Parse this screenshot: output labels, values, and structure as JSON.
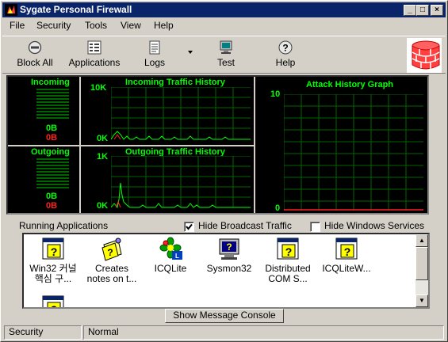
{
  "window": {
    "title": "Sygate Personal Firewall"
  },
  "title_buttons": {
    "minimize": "_",
    "maximize": "□",
    "close": "×"
  },
  "menu": [
    "File",
    "Security",
    "Tools",
    "View",
    "Help"
  ],
  "toolbar": {
    "block_all": "Block All",
    "applications": "Applications",
    "logs": "Logs",
    "test": "Test",
    "help": "Help"
  },
  "graphs": {
    "incoming": {
      "title": "Incoming",
      "count_a": "0B",
      "count_b": "0B"
    },
    "outgoing": {
      "title": "Outgoing",
      "count_a": "0B",
      "count_b": "0B"
    },
    "incoming_history": {
      "title": "Incoming Traffic History",
      "max": "10K",
      "min": "0K"
    },
    "outgoing_history": {
      "title": "Outgoing Traffic History",
      "max": "1K",
      "min": "0K"
    },
    "attack_history": {
      "title": "Attack History Graph",
      "max": "10",
      "min": "0"
    },
    "colors": {
      "green": "#00ff00",
      "red": "#ff2020",
      "grid": "#006600"
    }
  },
  "apps": {
    "label": "Running Applications",
    "hide_broadcast": {
      "label": "Hide Broadcast Traffic",
      "checked": true
    },
    "hide_windows_services": {
      "label": "Hide Windows Services",
      "checked": false
    },
    "items": [
      {
        "line1": "Win32 커널",
        "line2": "핵심 구...",
        "icon": "unknown-app-icon"
      },
      {
        "line1": "Creates",
        "line2": "notes on t...",
        "icon": "notes-icon"
      },
      {
        "line1": "ICQLite",
        "line2": "",
        "icon": "icq-icon"
      },
      {
        "line1": "Sysmon32",
        "line2": "",
        "icon": "monitor-icon"
      },
      {
        "line1": "Distributed",
        "line2": "COM S...",
        "icon": "unknown-app-icon"
      },
      {
        "line1": "ICQLiteW...",
        "line2": "",
        "icon": "unknown-app-icon"
      },
      {
        "line1": "",
        "line2": "",
        "icon": "unknown-app-icon"
      }
    ]
  },
  "console_button": "Show Message Console",
  "status": {
    "left": "Security",
    "right": "Normal"
  }
}
